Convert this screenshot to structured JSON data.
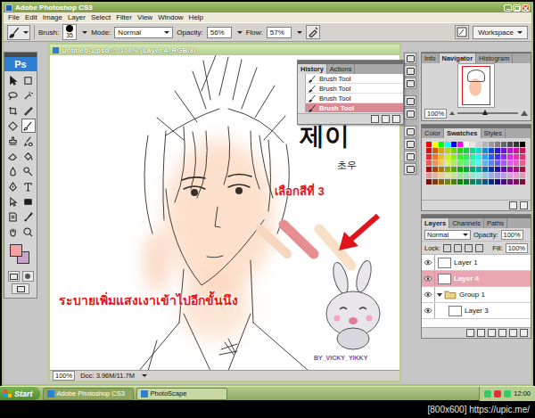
{
  "window": {
    "title": "Adobe Photoshop CS3"
  },
  "menu": [
    "File",
    "Edit",
    "Image",
    "Layer",
    "Select",
    "Filter",
    "View",
    "Window",
    "Help"
  ],
  "options": {
    "brush_label": "Brush:",
    "brush_size": "35",
    "mode_label": "Mode:",
    "mode": "Normal",
    "opacity_label": "Opacity:",
    "opacity": "56%",
    "flow_label": "Flow:",
    "flow": "57%",
    "workspace": "Workspace"
  },
  "toolbox": {
    "logo": "Ps",
    "tools": [
      {
        "selected": false
      },
      {
        "selected": false
      },
      {
        "selected": false
      },
      {
        "selected": false
      },
      {
        "selected": false
      },
      {
        "selected": false
      },
      {
        "selected": false
      },
      {
        "selected": true
      },
      {
        "selected": false
      },
      {
        "selected": false
      },
      {
        "selected": false
      },
      {
        "selected": false
      },
      {
        "selected": false
      },
      {
        "selected": false
      },
      {
        "selected": false
      },
      {
        "selected": false
      },
      {
        "selected": false
      },
      {
        "selected": false
      },
      {
        "selected": false
      },
      {
        "selected": false
      },
      {
        "selected": false
      },
      {
        "selected": false
      }
    ],
    "colors": [
      {
        "name": "foreground",
        "color": "#f2a2a2"
      },
      {
        "name": "background",
        "color": "#c8a2c8"
      }
    ]
  },
  "document": {
    "title": "Untitled-1.psd @ 100% (Layer 4, RGB/8)",
    "zoom": "100%",
    "doc_size": "Doc: 3.96M/11.7M",
    "annotations": [
      {
        "text": "제이",
        "kind": "title"
      },
      {
        "text": "초우",
        "kind": "small"
      },
      {
        "text": "เลือกสีที่ 3",
        "kind": "note"
      },
      {
        "text": "ระบายเพิ่มแสงเงาเข้าไปอีกขั้นนึง",
        "kind": "caption"
      }
    ],
    "strokes": [
      {
        "color": "#f7d6bf"
      },
      {
        "color": "#e68e92"
      },
      {
        "color": "#f8e0c6"
      }
    ],
    "watermark": "BY_VICKY_YIKKY"
  },
  "history": {
    "tabs": [
      {
        "label": "History",
        "selected": true
      },
      {
        "label": "Actions",
        "selected": false
      }
    ],
    "items": [
      {
        "label": "Brush Tool",
        "selected": false
      },
      {
        "label": "Brush Tool",
        "selected": false
      },
      {
        "label": "Brush Tool",
        "selected": false
      },
      {
        "label": "Brush Tool",
        "selected": true
      }
    ]
  },
  "navigator": {
    "tabs": [
      {
        "label": "Info",
        "selected": false
      },
      {
        "label": "Navigator",
        "selected": true
      },
      {
        "label": "Histogram",
        "selected": false
      }
    ],
    "zoom": "100%",
    "level": 0.45
  },
  "color_panel": {
    "tabs": [
      {
        "label": "Color",
        "selected": false
      },
      {
        "label": "Swatches",
        "selected": true
      },
      {
        "label": "Styles",
        "selected": false
      }
    ]
  },
  "layers_panel": {
    "tabs": [
      {
        "label": "Layers",
        "selected": true
      },
      {
        "label": "Channels",
        "selected": false
      },
      {
        "label": "Paths",
        "selected": false
      }
    ],
    "blend_mode": "Normal",
    "opacity_label": "Opacity:",
    "opacity": "100%",
    "lock_label": "Lock:",
    "fill_label": "Fill:",
    "fill": "100%",
    "layers": [
      {
        "name": "Layer 1",
        "kind": "layer",
        "selected": false,
        "visible": true,
        "expanded": false
      },
      {
        "name": "Layer 4",
        "kind": "layer",
        "selected": true,
        "visible": true,
        "expanded": false
      },
      {
        "name": "Group 1",
        "kind": "group",
        "selected": false,
        "visible": true,
        "expanded": true
      },
      {
        "name": "Layer 3",
        "kind": "nested",
        "selected": false,
        "visible": true,
        "expanded": false
      }
    ]
  },
  "taskbar": {
    "start": "Start",
    "buttons": [
      {
        "label": "Adobe Photoshop CS3",
        "selected": true
      },
      {
        "label": "PhotoScape",
        "selected": false
      }
    ],
    "clock": "12:00"
  },
  "caption": "[800x600] https://upic.me/"
}
